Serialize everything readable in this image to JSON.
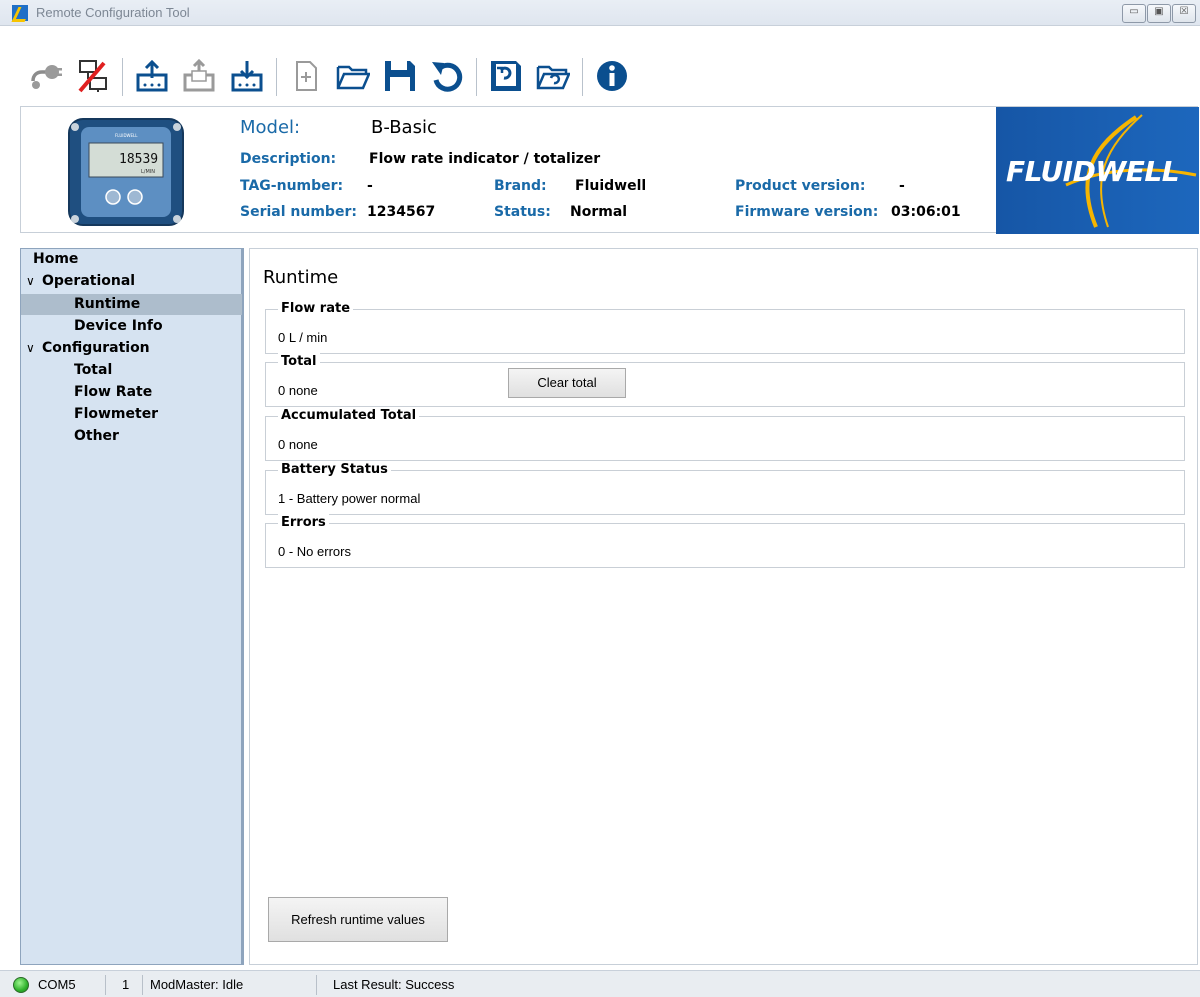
{
  "window": {
    "title": "Remote Configuration Tool",
    "controls": {
      "minimize": "▭",
      "maximize": "▣",
      "close": "☒"
    }
  },
  "toolbar": {
    "buttons": [
      {
        "name": "connect-icon",
        "icon": "plug-disabled"
      },
      {
        "name": "disconnect-icon",
        "icon": "network-x"
      },
      {
        "name": "upload-icon",
        "icon": "upload-to-device"
      },
      {
        "name": "upload-log-icon",
        "icon": "upload-log-disabled"
      },
      {
        "name": "download-icon",
        "icon": "download-from-device"
      },
      {
        "name": "new-file-icon",
        "icon": "new-file-disabled"
      },
      {
        "name": "open-folder-icon",
        "icon": "open-folder"
      },
      {
        "name": "save-icon",
        "icon": "floppy"
      },
      {
        "name": "undo-icon",
        "icon": "undo"
      },
      {
        "name": "save-device-icon",
        "icon": "floppy-device"
      },
      {
        "name": "open-device-icon",
        "icon": "folder-device"
      },
      {
        "name": "info-icon",
        "icon": "info"
      }
    ]
  },
  "header": {
    "model_label": "Model:",
    "model_value": "B-Basic",
    "description_label": "Description:",
    "description_value": "Flow rate indicator / totalizer",
    "tag_label": "TAG-number:",
    "tag_value": "-",
    "serial_label": "Serial number:",
    "serial_value": "1234567",
    "brand_label": "Brand:",
    "brand_value": "Fluidwell",
    "status_label": "Status:",
    "status_value": "Normal",
    "product_version_label": "Product version:",
    "product_version_value": "-",
    "firmware_version_label": "Firmware version:",
    "firmware_version_value": "03:06:01",
    "logo_text": "FLUIDWELL",
    "device_display": "18539",
    "device_unit": "L/MIN",
    "device_brand": "FLUIDWELL"
  },
  "sidebar": {
    "items": [
      {
        "label": "Home",
        "chevron": ""
      },
      {
        "label": "Operational",
        "chevron": "∨"
      },
      {
        "label": "Runtime",
        "chevron": ""
      },
      {
        "label": "Device Info",
        "chevron": ""
      },
      {
        "label": "Configuration",
        "chevron": "∨"
      },
      {
        "label": "Total",
        "chevron": ""
      },
      {
        "label": "Flow Rate",
        "chevron": ""
      },
      {
        "label": "Flowmeter",
        "chevron": ""
      },
      {
        "label": "Other",
        "chevron": ""
      }
    ]
  },
  "content": {
    "title": "Runtime",
    "groups": [
      {
        "label": "Flow rate",
        "value": "0 L / min"
      },
      {
        "label": "Total",
        "value": "0 none"
      },
      {
        "label": "Accumulated Total",
        "value": "0 none"
      },
      {
        "label": "Battery Status",
        "value": "1 - Battery power normal"
      },
      {
        "label": "Errors",
        "value": "0 - No errors"
      }
    ],
    "clear_total_label": "Clear total",
    "refresh_label": "Refresh runtime values"
  },
  "statusbar": {
    "port": "COM5",
    "address": "1",
    "modmaster": "ModMaster: Idle",
    "last_result": "Last Result: Success",
    "led_color": "#2fb22c"
  }
}
